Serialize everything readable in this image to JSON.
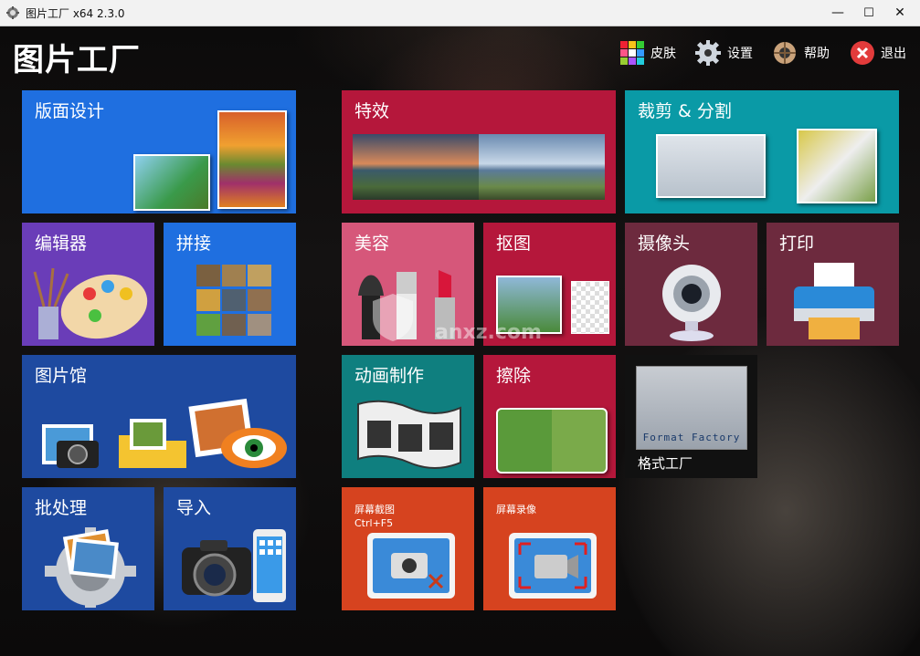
{
  "window": {
    "title": "图片工厂 x64 2.3.0",
    "minimize": "—",
    "maximize": "☐",
    "close": "✕"
  },
  "header": {
    "app_name": "图片工厂",
    "buttons": [
      {
        "label": "皮肤",
        "icon": "skin-palette-icon"
      },
      {
        "label": "设置",
        "icon": "gear-icon"
      },
      {
        "label": "帮助",
        "icon": "help-icon"
      },
      {
        "label": "退出",
        "icon": "exit-icon"
      }
    ]
  },
  "tiles": {
    "layout_design": {
      "label": "版面设计",
      "color": "#1f6fe0"
    },
    "effects": {
      "label": "特效",
      "color": "#b5173b"
    },
    "crop_split": {
      "label": "裁剪 & 分割",
      "color": "#0a9aa6"
    },
    "editor": {
      "label": "编辑器",
      "color": "#6a3db8"
    },
    "stitch": {
      "label": "拼接",
      "color": "#1f6fe0"
    },
    "beauty": {
      "label": "美容",
      "color": "#d6577a"
    },
    "cutout": {
      "label": "抠图",
      "color": "#b5173b"
    },
    "camera": {
      "label": "摄像头",
      "color": "#6d2a3e"
    },
    "print": {
      "label": "打印",
      "color": "#6d2a3e"
    },
    "gallery": {
      "label": "图片馆",
      "color": "#1e4aa0"
    },
    "animation": {
      "label": "动画制作",
      "color": "#0f7f7f"
    },
    "erase": {
      "label": "擦除",
      "color": "#b5173b"
    },
    "format_factory": {
      "label": "格式工厂",
      "image_text": "Format Factory",
      "color": "#111111"
    },
    "batch": {
      "label": "批处理",
      "color": "#1e4aa0"
    },
    "import": {
      "label": "导入",
      "color": "#1e4aa0"
    },
    "screenshot": {
      "label": "屏幕截图",
      "hotkey": "Ctrl+F5",
      "color": "#d6431f"
    },
    "screen_record": {
      "label": "屏幕录像",
      "color": "#d6431f"
    }
  },
  "watermark": {
    "text": "anxz.com"
  }
}
